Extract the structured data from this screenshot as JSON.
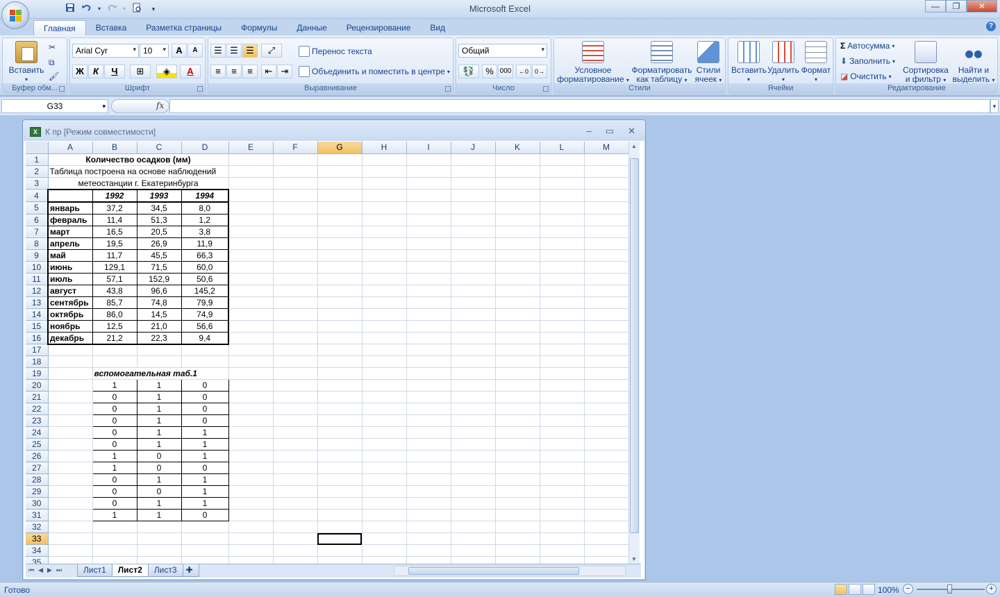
{
  "app": {
    "title": "Microsoft Excel"
  },
  "qat": {
    "save_icon": "save-icon",
    "undo_icon": "undo-icon",
    "redo_icon": "redo-icon",
    "print_preview_icon": "print-preview-icon",
    "customize_icon": "customize-qat-icon"
  },
  "ribbon_tabs": [
    "Главная",
    "Вставка",
    "Разметка страницы",
    "Формулы",
    "Данные",
    "Рецензирование",
    "Вид"
  ],
  "ribbon": {
    "clipboard": {
      "label": "Буфер обм...",
      "paste": "Вставить"
    },
    "font": {
      "label": "Шрифт",
      "font_name": "Arial Cyr",
      "font_size": "10",
      "grow": "A",
      "shrink": "A",
      "bold": "Ж",
      "italic": "К",
      "underline": "Ч"
    },
    "alignment": {
      "label": "Выравнивание",
      "wrap": "Перенос текста",
      "merge": "Объединить и поместить в центре"
    },
    "number": {
      "label": "Число",
      "format": "Общий",
      "percent": "%",
      "thousands": "000"
    },
    "styles": {
      "label": "Стили",
      "conditional": [
        "Условное",
        "форматирование"
      ],
      "as_table": [
        "Форматировать",
        "как таблицу"
      ],
      "cell_styles": [
        "Стили",
        "ячеек"
      ]
    },
    "cells": {
      "label": "Ячейки",
      "insert": "Вставить",
      "delete": "Удалить",
      "format": "Формат"
    },
    "editing": {
      "label": "Редактирование",
      "autosum": "Автосумма",
      "fill": "Заполнить",
      "clear": "Очистить",
      "sort": [
        "Сортировка",
        "и фильтр"
      ],
      "find": [
        "Найти и",
        "выделить"
      ]
    }
  },
  "formula_bar": {
    "name_box": "G33",
    "fx": "fx",
    "value": ""
  },
  "workbook": {
    "title": "К пр  [Режим совместимости]"
  },
  "sheet": {
    "columns": [
      "A",
      "B",
      "C",
      "D",
      "E",
      "F",
      "G",
      "H",
      "I",
      "J",
      "K",
      "L",
      "M"
    ],
    "selected_column": "G",
    "selected_row": 33,
    "rows": [
      {
        "n": 1,
        "cells": {
          "A": "Количество осадков (мм)"
        }
      },
      {
        "n": 2,
        "cells": {
          "A": "Таблица построена на основе наблюдений"
        }
      },
      {
        "n": 3,
        "cells": {
          "A": "метеостанции г. Екатеринбурга"
        }
      },
      {
        "n": 4,
        "cells": {
          "A": "",
          "B": "1992",
          "C": "1993",
          "D": "1994"
        }
      },
      {
        "n": 5,
        "cells": {
          "A": "январь",
          "B": "37,2",
          "C": "34,5",
          "D": "8,0"
        }
      },
      {
        "n": 6,
        "cells": {
          "A": "февраль",
          "B": "11,4",
          "C": "51,3",
          "D": "1,2"
        }
      },
      {
        "n": 7,
        "cells": {
          "A": "март",
          "B": "16,5",
          "C": "20,5",
          "D": "3,8"
        }
      },
      {
        "n": 8,
        "cells": {
          "A": "апрель",
          "B": "19,5",
          "C": "26,9",
          "D": "11,9"
        }
      },
      {
        "n": 9,
        "cells": {
          "A": "май",
          "B": "11,7",
          "C": "45,5",
          "D": "66,3"
        }
      },
      {
        "n": 10,
        "cells": {
          "A": "июнь",
          "B": "129,1",
          "C": "71,5",
          "D": "60,0"
        }
      },
      {
        "n": 11,
        "cells": {
          "A": "июль",
          "B": "57,1",
          "C": "152,9",
          "D": "50,6"
        }
      },
      {
        "n": 12,
        "cells": {
          "A": "август",
          "B": "43,8",
          "C": "96,6",
          "D": "145,2"
        }
      },
      {
        "n": 13,
        "cells": {
          "A": "сентябрь",
          "B": "85,7",
          "C": "74,8",
          "D": "79,9"
        }
      },
      {
        "n": 14,
        "cells": {
          "A": "октябрь",
          "B": "86,0",
          "C": "14,5",
          "D": "74,9"
        }
      },
      {
        "n": 15,
        "cells": {
          "A": "ноябрь",
          "B": "12,5",
          "C": "21,0",
          "D": "56,6"
        }
      },
      {
        "n": 16,
        "cells": {
          "A": "декабрь",
          "B": "21,2",
          "C": "22,3",
          "D": "9,4"
        }
      },
      {
        "n": 17,
        "cells": {}
      },
      {
        "n": 18,
        "cells": {}
      },
      {
        "n": 19,
        "cells": {
          "B": "вспомогательная таб.1"
        }
      },
      {
        "n": 20,
        "cells": {
          "B": "1",
          "C": "1",
          "D": "0"
        }
      },
      {
        "n": 21,
        "cells": {
          "B": "0",
          "C": "1",
          "D": "0"
        }
      },
      {
        "n": 22,
        "cells": {
          "B": "0",
          "C": "1",
          "D": "0"
        }
      },
      {
        "n": 23,
        "cells": {
          "B": "0",
          "C": "1",
          "D": "0"
        }
      },
      {
        "n": 24,
        "cells": {
          "B": "0",
          "C": "1",
          "D": "1"
        }
      },
      {
        "n": 25,
        "cells": {
          "B": "0",
          "C": "1",
          "D": "1"
        }
      },
      {
        "n": 26,
        "cells": {
          "B": "1",
          "C": "0",
          "D": "1"
        }
      },
      {
        "n": 27,
        "cells": {
          "B": "1",
          "C": "0",
          "D": "0"
        }
      },
      {
        "n": 28,
        "cells": {
          "B": "0",
          "C": "1",
          "D": "1"
        }
      },
      {
        "n": 29,
        "cells": {
          "B": "0",
          "C": "0",
          "D": "1"
        }
      },
      {
        "n": 30,
        "cells": {
          "B": "0",
          "C": "1",
          "D": "1"
        }
      },
      {
        "n": 31,
        "cells": {
          "B": "1",
          "C": "1",
          "D": "0"
        }
      },
      {
        "n": 32,
        "cells": {}
      },
      {
        "n": 33,
        "cells": {}
      },
      {
        "n": 34,
        "cells": {}
      },
      {
        "n": 35,
        "cells": {}
      }
    ]
  },
  "sheet_tabs": [
    "Лист1",
    "Лист2",
    "Лист3"
  ],
  "active_sheet": "Лист2",
  "status": {
    "text": "Готово",
    "zoom": "100%",
    "minus": "−",
    "plus": "+"
  }
}
